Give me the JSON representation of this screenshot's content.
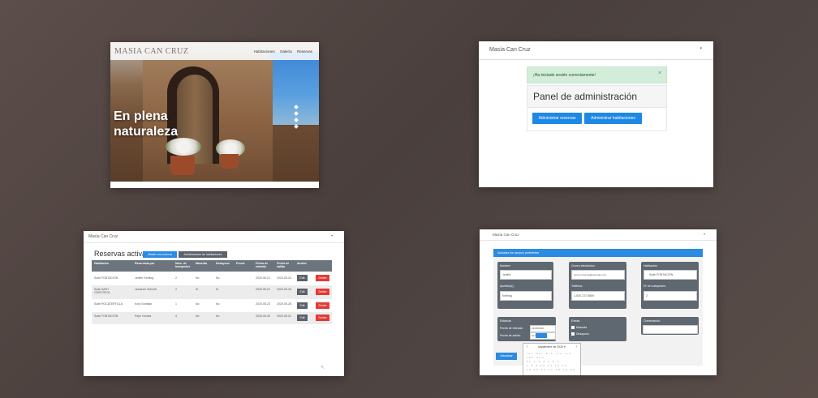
{
  "shot_home": {
    "brand": "MASIA CAN CRUZ",
    "nav": [
      "Habitaciones",
      "Galería",
      "Reservas"
    ],
    "headline_line1": "En plena",
    "headline_line2": "naturaleza"
  },
  "shot_admin": {
    "brand": "Masía Can Cruz",
    "caret": "▾",
    "alert": "¡Ha iniciado sesión correctamente!",
    "alert_close": "×",
    "panel_title": "Panel de administración",
    "btn_reservations": "Administrar reservas",
    "btn_rooms": "Administrar habitaciones"
  },
  "shot_reservations": {
    "brand": "Masía Can Cruz",
    "caret": "▾",
    "title": "Reservas activas",
    "btn_add": "Añadir una reserva",
    "btn_rooms": "Administrador de habitaciones",
    "headers": [
      "Habitación",
      "Reservada por",
      "Núm. de huéspedes",
      "Mascota",
      "Desayuno",
      "Precio",
      "Fecha de entrada",
      "Fecha de salida",
      "Acción"
    ],
    "rows": [
      {
        "room": "Suite FONTACIÓN",
        "by": "Jenifer Keeling",
        "guests": "2",
        "pet": "No",
        "breakfast": "No",
        "checkin": "2020-05-21",
        "checkout": "2020-05-24"
      },
      {
        "room": "Suite SANT CRISTÒFOL",
        "by": "Jamarcio Schmitt",
        "guests": "2",
        "pet": "Sí",
        "breakfast": "Sí",
        "checkin": "2020-05-21",
        "checkout": "2020-05-26"
      },
      {
        "room": "Suite ROCATERTILLA",
        "by": "Kory Gorlaski",
        "guests": "1",
        "pet": "No",
        "breakfast": "No",
        "checkin": "2020-05-23",
        "checkout": "2020-05-28"
      },
      {
        "room": "Suite FONTACIÓN",
        "by": "Pepe Gomez",
        "guests": "4",
        "pet": "No",
        "breakfast": "No",
        "checkin": "2020-05-30",
        "checkout": "2020-05-31"
      }
    ],
    "edit_label": "Edit",
    "delete_label": "Delete"
  },
  "shot_update": {
    "brand": "Masía Can Cruz",
    "caret": "▾",
    "header": "Actualiza los campos pertinentes",
    "name_label": "Nombre:",
    "name_value": "Jenifer",
    "email_label": "Correo electrónico:",
    "email_value": "correo.reserva@example.com",
    "room_label": "Habitación:",
    "room_value": "Suite FONTACIÓN",
    "surname_label": "Apellido(s):",
    "surname_value": "Keeling",
    "phone_label": "Teléfono:",
    "phone_value": "1-530-727-5669",
    "guests_label": "Nº de huéspedes:",
    "guests_value": "2",
    "stay_label": "Estancia:",
    "checkin_label": "Fecha de entrada:",
    "checkin_value": "21/05/2020",
    "checkout_label": "Fecha de salida:",
    "checkout_value": "dd / mm /",
    "extras_label": "Extras:",
    "pet_label": "Mascota",
    "breakfast_label": "Desayuno",
    "comments_label": "Comentarios:",
    "update_button": "Actualizar",
    "calendar_month": "septiembre de 2020 ▾",
    "calendar_prev": "‹",
    "calendar_next": "›",
    "calendar_days": "lun mar mié jue vie sáb dom",
    "calendar_row1": "31 1 2 3 4 5 6",
    "calendar_row2": "7 8 9 10 11 12 13",
    "calendar_row3": "14 15 16 17 18 19 20"
  }
}
